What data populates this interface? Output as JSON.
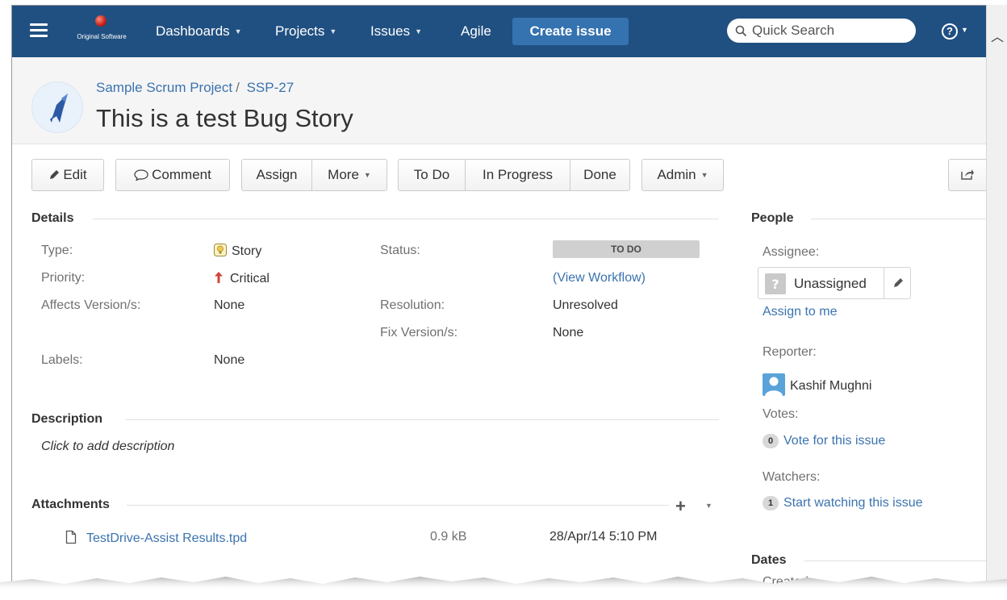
{
  "nav": {
    "logo_text": "Original Software",
    "dashboards": "Dashboards",
    "projects": "Projects",
    "issues": "Issues",
    "agile": "Agile",
    "create_issue": "Create issue",
    "search_placeholder": "Quick Search",
    "help": "?"
  },
  "issue": {
    "project": "Sample Scrum Project",
    "separator": "/",
    "key": "SSP-27",
    "title": "This is a test Bug Story"
  },
  "toolbar": {
    "edit": "Edit",
    "comment": "Comment",
    "assign": "Assign",
    "more": "More",
    "todo": "To Do",
    "in_progress": "In Progress",
    "done": "Done",
    "admin": "Admin"
  },
  "details": {
    "heading": "Details",
    "type_label": "Type:",
    "type_value": "Story",
    "priority_label": "Priority:",
    "priority_value": "Critical",
    "affects_label": "Affects Version/s:",
    "affects_value": "None",
    "labels_label": "Labels:",
    "labels_value": "None",
    "status_label": "Status:",
    "status_value": "TO DO",
    "view_workflow": "(View Workflow)",
    "resolution_label": "Resolution:",
    "resolution_value": "Unresolved",
    "fix_label": "Fix Version/s:",
    "fix_value": "None"
  },
  "description": {
    "heading": "Description",
    "placeholder": "Click to add description"
  },
  "attachments": {
    "heading": "Attachments",
    "items": [
      {
        "name": "TestDrive-Assist Results.tpd",
        "size": "0.9 kB",
        "date": "28/Apr/14 5:10 PM"
      }
    ]
  },
  "people": {
    "heading": "People",
    "assignee_label": "Assignee:",
    "assignee_value": "Unassigned",
    "assign_to_me": "Assign to me",
    "reporter_label": "Reporter:",
    "reporter_value": "Kashif Mughni",
    "votes_label": "Votes:",
    "votes_count": "0",
    "vote_link": "Vote for this issue",
    "watchers_label": "Watchers:",
    "watchers_count": "1",
    "watch_link": "Start watching this issue"
  },
  "dates": {
    "heading": "Dates",
    "created_label": "Created:"
  },
  "colors": {
    "navbar": "#205081",
    "create_button": "#3572b0",
    "link": "#3b73af",
    "priority_critical": "#d04437"
  }
}
